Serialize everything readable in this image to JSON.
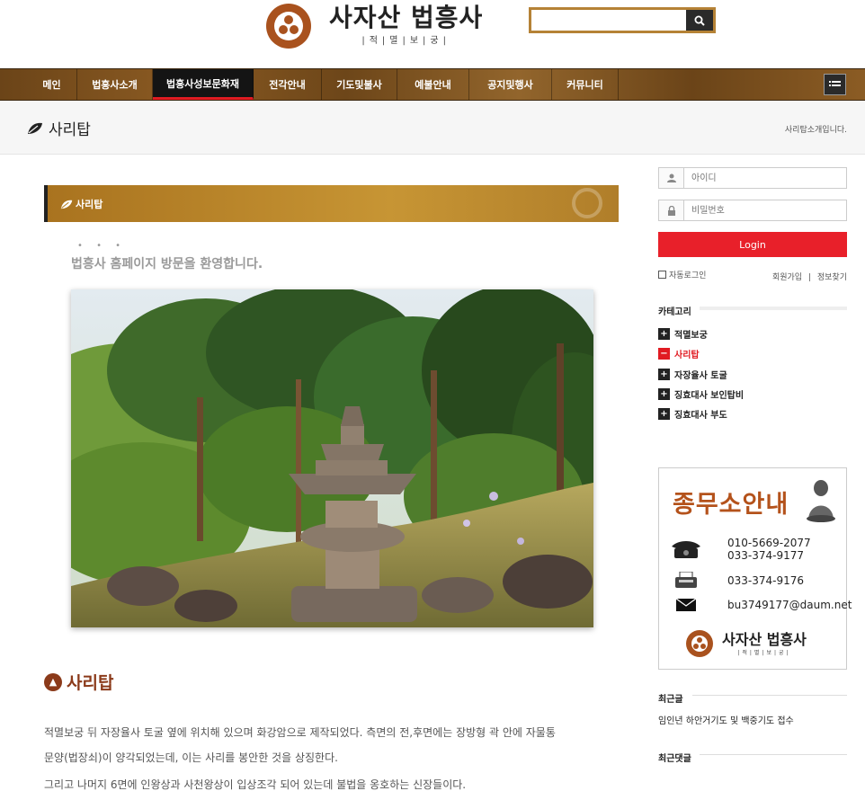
{
  "header": {
    "logo_title": "사자산 법흥사",
    "logo_sub": "|적|멸|보|궁|",
    "search_placeholder": ""
  },
  "nav": {
    "items": [
      "메인",
      "법흥사소개",
      "법흥사성보문화재",
      "전각안내",
      "기도및불사",
      "예불안내",
      "공지및행사",
      "커뮤니티"
    ],
    "active_index": 2
  },
  "page": {
    "title": "사리탑",
    "description": "사리탑소개입니다."
  },
  "main": {
    "section_label": "사리탑",
    "dots": "• • •",
    "welcome": "법흥사 홈페이지 방문을 환영합니다.",
    "heading": "사리탑",
    "paragraph_1": "적멸보궁 뒤 자장율사 토굴 옆에 위치해 있으며 화강암으로 제작되었다. 측면의 전,후면에는 장방형 곽 안에 자물통",
    "paragraph_2": "문양(법장쇠)이 양각되었는데, 이는 사리를 봉안한 것을 상징한다.",
    "paragraph_3": "그리고 나머지 6면에 인왕상과 사천왕상이 입상조각 되어 있는데 불법을 옹호하는 신장들이다."
  },
  "sidebar": {
    "login": {
      "id_placeholder": "아이디",
      "pw_placeholder": "비밀번호",
      "button": "Login",
      "auto_login": "자동로그인",
      "join": "회원가입",
      "separator": "|",
      "find": "정보찾기"
    },
    "category_title": "카테고리",
    "categories": [
      {
        "label": "적멸보궁",
        "sign": "+"
      },
      {
        "label": "사리탑",
        "sign": "−"
      },
      {
        "label": "자장율사 토굴",
        "sign": "+"
      },
      {
        "label": "징효대사 보인탑비",
        "sign": "+"
      },
      {
        "label": "징효대사 부도",
        "sign": "+"
      }
    ],
    "office": {
      "title": "종무소안내",
      "phone_1": "010-5669-2077",
      "phone_2": "033-374-9177",
      "fax": "033-374-9176",
      "email": "bu3749177@daum.net",
      "logo_title": "사자산 법흥사",
      "logo_sub": "|적|멸|보|궁|"
    },
    "recent_posts_title": "최근글",
    "recent_post": "임인년 하안거기도 및 백중기도 접수",
    "recent_comments_title": "최근댓글"
  },
  "colors": {
    "accent_red": "#e11b22",
    "brown": "#a9521e",
    "gold": "#c79534"
  }
}
